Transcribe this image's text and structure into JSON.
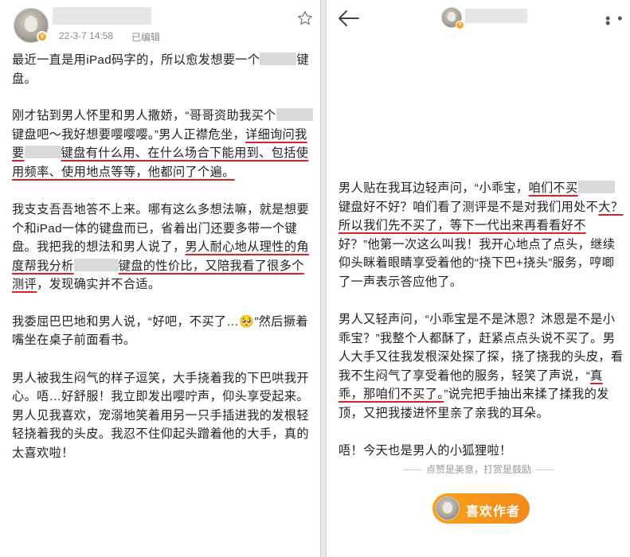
{
  "left": {
    "timestamp": "22-3-7 14:58",
    "edited": "已编辑",
    "paragraphs": [
      [
        "最近一直是用iPad码字的，所以愈发想要一个",
        "[blur]",
        "键盘。"
      ],
      [
        "刚才钻到男人怀里和男人撒娇，“哥哥资助我买个",
        "[blur]",
        "键盘吧～我好想要嘤嘤嘤。”男人正襟危坐，",
        "[hl]详细询问我要",
        "[blur]",
        "[hl]键盘有什么用、在什么场合下能用到、包括使用频率、使用地点等等，他都问了个遍。"
      ],
      [
        "我支支吾吾地答不上来。哪有这么多想法嘛，就是想要个和iPad一体的键盘而已，省着出门还要多带一个键盘。我把我的想法和男人说了，",
        "[hl]男人耐心地从理性的角度帮我分析",
        "[blur]",
        "[hl]键盘的性价比，又陪我看了很多个测评",
        "，发现确实并不合适。"
      ],
      [
        "我委屈巴巴地和男人说，“好吧，不买了…🥺”然后撅着嘴坐在桌子前面看书。"
      ],
      [
        "男人被我生闷气的样子逗笑，大手挠着我的下巴哄我开心。唔…好舒服！我立即发出嘤咛声，仰头享受起来。男人见我喜欢，宠溺地笑着用另一只手插进我的发根轻轻挠着我的头皮。我忍不住仰起头蹭着他的大手，真的太喜欢啦！"
      ]
    ]
  },
  "right": {
    "paragraphs": [
      [
        "男人贴在我耳边轻声问，“小乖宝，",
        "[hl]咱们不买",
        "[blur]",
        "键盘好不好？咱们看了测评是不是对我们用处不",
        "[hl]大？所以我们先不买了，等下一代出来再看看好不",
        "好？”他第一次这么叫我！我开心地点了点头，继续仰头眯着眼睛享受着他的“挠下巴+挠头”服务，哼唧了一声表示答应他了。"
      ],
      [
        "男人又轻声问，“小乖宝是不是沐恩？沐恩是不是小乖宝？”我整个人都酥了，赶紧点点头说不买了。男人大手又往我发根深处探了探，挠了挠我的头皮，看我不生闷气了享受着他的服务，轻笑了声说，“",
        "[hl]真乖，那咱们不买了。",
        "”说完把手抽出来揉了揉我的发顶，又把我搂进怀里亲了亲我的耳朵。"
      ],
      [
        "唔！今天也是男人的小狐狸啦！"
      ]
    ],
    "reward_caption": "点赞是美意，打赏是鼓励",
    "like_button_label": "喜欢作者"
  },
  "icons": {
    "star": "star-icon",
    "back": "back-arrow-icon",
    "more": "more-icon",
    "verified": "verified-badge-icon"
  },
  "colors": {
    "underline": "#d8232a",
    "accent": "#f5a623"
  }
}
